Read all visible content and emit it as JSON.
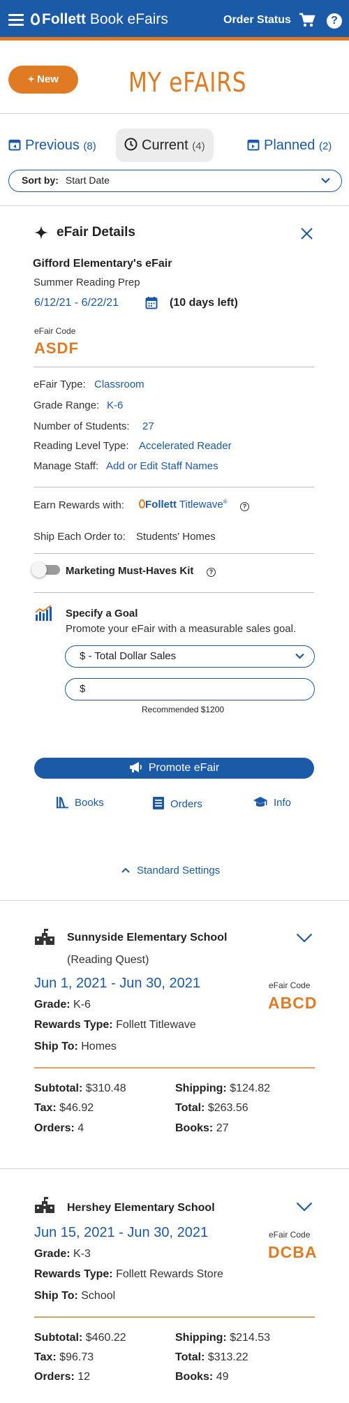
{
  "header": {
    "brand": "Follett",
    "product": "Book eFairs",
    "order_status": "Order Status",
    "help": "?"
  },
  "toolbar": {
    "new_label": "+ New",
    "page_title": "MY eFAIRS"
  },
  "tabs": [
    {
      "label": "Previous",
      "count": "(8)"
    },
    {
      "label": "Current",
      "count": "(4)"
    },
    {
      "label": "Planned",
      "count": "(2)"
    }
  ],
  "sort": {
    "label": "Sort by:",
    "value": "Start Date"
  },
  "details": {
    "title": "eFair Details",
    "fair_name": "Gifford Elementary's eFair",
    "fair_subtitle": "Summer Reading Prep",
    "dates": "6/12/21 - 6/22/21",
    "days_left": "(10 days left)",
    "code_label": "eFair Code",
    "code": "ASDF",
    "type_label": "eFair Type:",
    "type_value": "Classroom",
    "grade_label": "Grade Range:",
    "grade_value": "K-6",
    "students_label": "Number of Students:",
    "students_value": "27",
    "reading_label": "Reading Level Type:",
    "reading_value": "Accelerated Reader",
    "staff_label": "Manage Staff:",
    "staff_value": "Add or Edit Staff Names",
    "rewards_label": "Earn Rewards with:",
    "rewards_brand": "Follett",
    "rewards_product": "Titlewave",
    "rewards_reg": "®",
    "ship_label": "Ship Each Order to:",
    "ship_value": "Students' Homes",
    "marketing_label": "Marketing Must-Haves Kit",
    "marketing_enabled": false,
    "goal_title": "Specify a Goal",
    "goal_desc": "Promote your eFair with a measurable sales goal.",
    "goal_type": "$ - Total Dollar Sales",
    "goal_prefix": "$",
    "goal_amount": "",
    "goal_recommend": "Recommended $1200",
    "promote_label": "Promote eFair",
    "books_label": "Books",
    "orders_label": "Orders",
    "info_label": "Info",
    "settings_label": "Standard Settings"
  },
  "fairs": [
    {
      "school": "Sunnyside Elementary School",
      "program": "(Reading Quest)",
      "dates": "Jun 1, 2021 - Jun 30, 2021",
      "code_label": "eFair Code",
      "code": "ABCD",
      "grade_label": "Grade:",
      "grade": "K-6",
      "rewards_label": "Rewards Type:",
      "rewards": "Follett Titlewave",
      "ship_label": "Ship To:",
      "ship": "Homes",
      "subtotal_label": "Subtotal:",
      "subtotal": "$310.48",
      "shipping_label": "Shipping:",
      "shipping": "$124.82",
      "tax_label": "Tax:",
      "tax": "$46.92",
      "total_label": "Total:",
      "total": "$263.56",
      "orders_label": "Orders:",
      "orders": "4",
      "books_label": "Books:",
      "books": "27"
    },
    {
      "school": "Hershey Elementary School",
      "dates": "Jun 15, 2021 - Jun 30, 2021",
      "code_label": "eFair Code",
      "code": "DCBA",
      "grade_label": "Grade:",
      "grade": "K-3",
      "rewards_label": "Rewards Type:",
      "rewards": "Follett Rewards Store",
      "ship_label": "Ship To:",
      "ship": "School",
      "subtotal_label": "Subtotal:",
      "subtotal": "$460.22",
      "shipping_label": "Shipping:",
      "shipping": "$214.53",
      "tax_label": "Tax:",
      "tax": "$96.73",
      "total_label": "Total:",
      "total": "$313.22",
      "orders_label": "Orders:",
      "orders": "12",
      "books_label": "Books:",
      "books": "49"
    }
  ],
  "colors": {
    "brand_blue": "#1a5aa6",
    "accent_orange": "#e07b24"
  }
}
